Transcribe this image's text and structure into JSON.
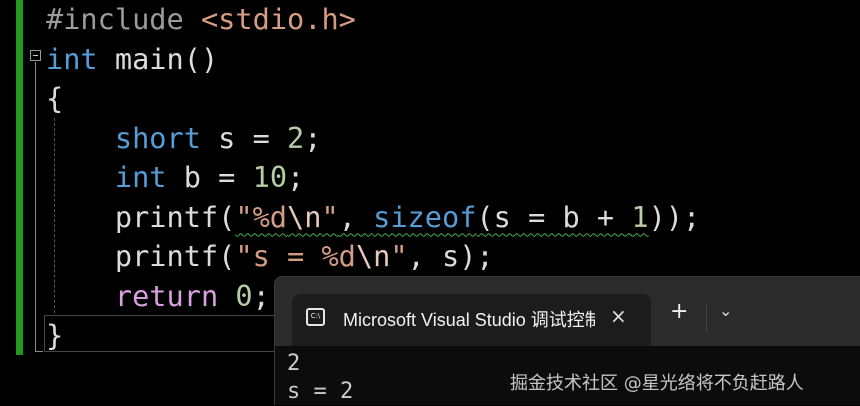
{
  "editor": {
    "lines": [
      {
        "parts": [
          "#include",
          " ",
          "<stdio.h>"
        ]
      },
      {
        "parts": [
          "int",
          " main()"
        ]
      },
      {
        "parts": [
          "{"
        ]
      },
      {
        "parts": [
          "    ",
          "short",
          " s = ",
          "2",
          ";"
        ]
      },
      {
        "parts": [
          "    ",
          "int",
          " b = ",
          "10",
          ";"
        ]
      },
      {
        "parts": [
          "    printf(",
          "\"%d",
          "\\n",
          "\"",
          ", ",
          "sizeof",
          "(s = b + ",
          "1",
          "));"
        ]
      },
      {
        "parts": [
          "    printf(",
          "\"s = %d",
          "\\n",
          "\"",
          ", s);"
        ]
      },
      {
        "parts": [
          "    ",
          "return",
          " ",
          "0",
          ";"
        ]
      },
      {
        "parts": [
          "}"
        ]
      }
    ]
  },
  "terminal": {
    "tab_icon_text": "C:\\",
    "tab_title": "Microsoft Visual Studio 调试控制台",
    "close_icon": "×",
    "new_tab_icon": "+",
    "dropdown_icon": "⌄",
    "output": [
      "2",
      "s = 2"
    ]
  },
  "watermark": "掘金技术社区 @星光络将不负赶路人"
}
